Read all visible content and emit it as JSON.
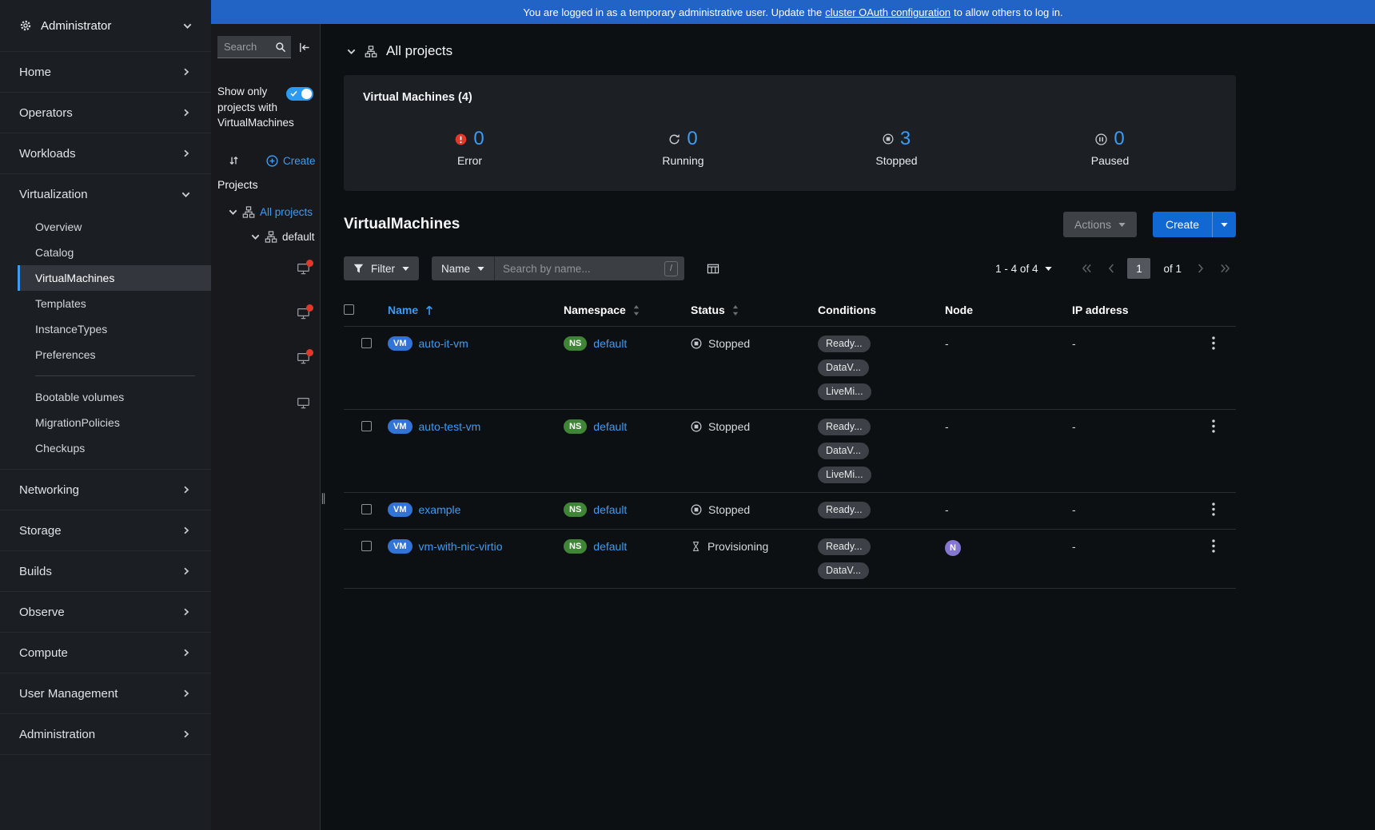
{
  "colors": {
    "banner_bg": "#2263c6",
    "link": "#3a9cf4",
    "primary": "#1268d2",
    "vm_badge": "#3273d6",
    "ns_badge": "#3e8635",
    "node_badge": "#8476d1",
    "error_red": "#e0382b"
  },
  "banner": {
    "text_before": "You are logged in as a temporary administrative user. Update the",
    "link_text": "cluster OAuth configuration",
    "text_after": "to allow others to log in."
  },
  "sidebar": {
    "perspective": "Administrator",
    "items": [
      {
        "label": "Home"
      },
      {
        "label": "Operators"
      },
      {
        "label": "Workloads"
      },
      {
        "label": "Virtualization",
        "expanded": true,
        "children": [
          {
            "label": "Overview"
          },
          {
            "label": "Catalog"
          },
          {
            "label": "VirtualMachines",
            "active": true
          },
          {
            "label": "Templates"
          },
          {
            "label": "InstanceTypes"
          },
          {
            "label": "Preferences"
          },
          {
            "divider": true
          },
          {
            "label": "Bootable volumes"
          },
          {
            "label": "MigrationPolicies"
          },
          {
            "label": "Checkups"
          }
        ]
      },
      {
        "label": "Networking"
      },
      {
        "label": "Storage"
      },
      {
        "label": "Builds"
      },
      {
        "label": "Observe"
      },
      {
        "label": "Compute"
      },
      {
        "label": "User Management"
      },
      {
        "label": "Administration"
      }
    ]
  },
  "tree": {
    "search_placeholder": "Search",
    "filter_label": "Show only projects with VirtualMachines",
    "toggle_state": "on",
    "create_label": "Create Project",
    "projects_heading": "Projects",
    "items": [
      {
        "type": "all",
        "label": "All projects",
        "selected": true
      },
      {
        "type": "project",
        "label": "default"
      },
      {
        "type": "vm",
        "alert": true
      },
      {
        "type": "vm",
        "alert": true
      },
      {
        "type": "vm",
        "alert": true
      },
      {
        "type": "vm",
        "alert": false
      }
    ]
  },
  "main": {
    "header_label": "All projects",
    "summary": {
      "title": "Virtual Machines (4)",
      "stats": [
        {
          "label": "Error",
          "value": "0",
          "icon": "error"
        },
        {
          "label": "Running",
          "value": "0",
          "icon": "running"
        },
        {
          "label": "Stopped",
          "value": "3",
          "icon": "stopped"
        },
        {
          "label": "Paused",
          "value": "0",
          "icon": "paused"
        }
      ]
    },
    "list": {
      "title": "VirtualMachines",
      "actions_label": "Actions",
      "create_label": "Create"
    },
    "toolbar": {
      "filter_label": "Filter",
      "attribute_label": "Name",
      "search_placeholder": "Search by name...",
      "shortcut_key": "/",
      "pagination": {
        "summary": "1 - 4 of 4",
        "current_page": "1",
        "of_pages": "of 1"
      }
    },
    "table": {
      "vm_badge_label": "VM",
      "ns_badge_label": "NS",
      "columns": [
        {
          "label": "Name",
          "sort": "asc"
        },
        {
          "label": "Namespace",
          "sortable": true
        },
        {
          "label": "Status",
          "sortable": true
        },
        {
          "label": "Conditions"
        },
        {
          "label": "Node"
        },
        {
          "label": "IP address"
        }
      ],
      "rows": [
        {
          "name": "auto-it-vm",
          "namespace": "default",
          "status": "Stopped",
          "status_icon": "stopped",
          "conditions": [
            "Ready...",
            "DataV...",
            "LiveMi..."
          ],
          "node": "-",
          "ip": "-"
        },
        {
          "name": "auto-test-vm",
          "namespace": "default",
          "status": "Stopped",
          "status_icon": "stopped",
          "conditions": [
            "Ready...",
            "DataV...",
            "LiveMi..."
          ],
          "node": "-",
          "ip": "-"
        },
        {
          "name": "example",
          "namespace": "default",
          "status": "Stopped",
          "status_icon": "stopped",
          "conditions": [
            "Ready..."
          ],
          "node": "-",
          "ip": "-"
        },
        {
          "name": "vm-with-nic-virtio",
          "namespace": "default",
          "status": "Provisioning",
          "status_icon": "provisioning",
          "conditions": [
            "Ready...",
            "DataV..."
          ],
          "node_badge": "N",
          "ip": "-"
        }
      ]
    }
  }
}
